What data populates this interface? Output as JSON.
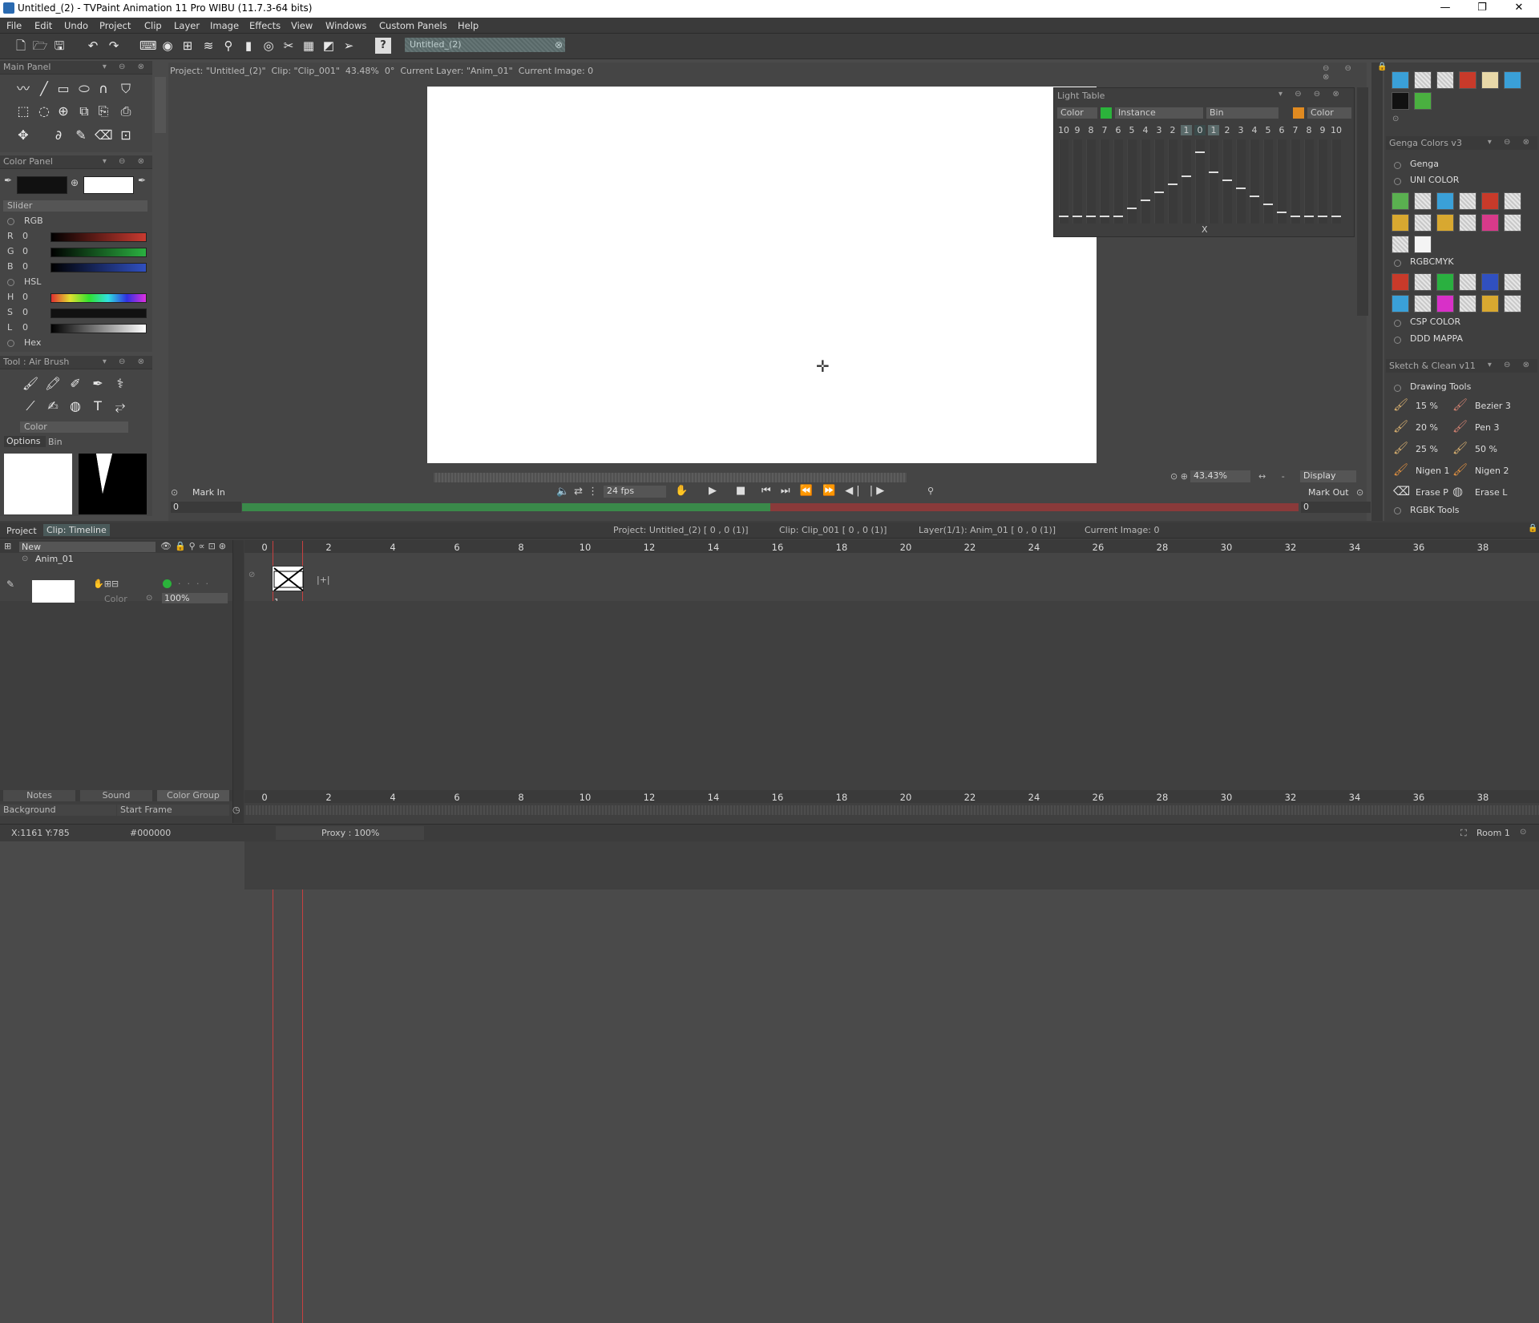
{
  "window": {
    "title": "Untitled_(2) - TVPaint Animation 11 Pro WIBU (11.7.3-64 bits)",
    "minimize": "—",
    "maximize": "❐",
    "close": "✕"
  },
  "menu": [
    "File",
    "Edit",
    "Undo",
    "Project",
    "Clip",
    "Layer",
    "Image",
    "Effects",
    "View",
    "Windows",
    "Custom Panels",
    "Help"
  ],
  "toolbar": {
    "doc_tab": "Untitled_(2)"
  },
  "main_panel": {
    "title": "Main Panel"
  },
  "info_bar": "Project: \"Untitled_(2)\"  Clip: \"Clip_001\"  43.48%  0°  Current Layer: \"Anim_01\"  Current Image: 0",
  "color_panel": {
    "title": "Color Panel",
    "slider_label": "Slider",
    "rgb_label": "RGB",
    "hsl_label": "HSL",
    "hex_label": "Hex",
    "rows": [
      {
        "label": "R",
        "value": "0"
      },
      {
        "label": "G",
        "value": "0"
      },
      {
        "label": "B",
        "value": "0"
      },
      {
        "label": "H",
        "value": "0"
      },
      {
        "label": "S",
        "value": "0"
      },
      {
        "label": "L",
        "value": "0"
      }
    ],
    "primary_color": "#111111",
    "secondary_color": "#ffffff"
  },
  "tool_panel": {
    "title": "Tool : Air Brush",
    "mode": "Color",
    "tabs": [
      "Options",
      "Bin"
    ]
  },
  "light_table": {
    "title": "Light Table",
    "header": {
      "color1": "Color",
      "instance": "Instance",
      "bin": "Bin",
      "color2": "Color"
    },
    "numbers": [
      "10",
      "9",
      "8",
      "7",
      "6",
      "5",
      "4",
      "3",
      "2",
      "1",
      "0",
      "1",
      "2",
      "3",
      "4",
      "5",
      "6",
      "7",
      "8",
      "9",
      "10"
    ],
    "x_label": "X"
  },
  "playback": {
    "mark_in": "Mark In",
    "fps": "24 fps",
    "mark_out": "Mark Out",
    "start_value": "0",
    "end_value": "0",
    "zoom": "43.43%",
    "display": "Display"
  },
  "right_panel": {
    "genga_title": "Genga Colors v3",
    "genga": "Genga",
    "uni_color": "UNI COLOR",
    "rgbcmyk": "RGBCMYK",
    "csp_color": "CSP COLOR",
    "ddd_mappa": "DDD MAPPA",
    "sketch_title": "Sketch & Clean v11",
    "drawing_tools": "Drawing Tools",
    "tools": [
      {
        "left": "15 %",
        "right": "Bezier 3"
      },
      {
        "left": "20 %",
        "right": "Pen 3"
      },
      {
        "left": "25 %",
        "right": "50 %"
      },
      {
        "left": "Nigen 1",
        "right": "Nigen 2"
      },
      {
        "left": "Erase P",
        "right": "Erase L"
      }
    ],
    "rgbk_tools": "RGBK Tools"
  },
  "timeline": {
    "tabs": [
      "Project",
      "Clip: Timeline"
    ],
    "info": {
      "project": "Project: Untitled_(2) [ 0 , 0  (1)]",
      "clip": "Clip: Clip_001 [ 0 , 0  (1)]",
      "layer": "Layer(1/1): Anim_01 [ 0 , 0  (1)]",
      "image": "Current Image: 0"
    },
    "new_label": "New",
    "layer_name": "Anim_01",
    "blend_mode": "Color",
    "opacity": "100%",
    "frame_label": "1",
    "ruler": [
      "0",
      "2",
      "4",
      "6",
      "8",
      "10",
      "12",
      "14",
      "16",
      "18",
      "20",
      "22",
      "24",
      "26",
      "28",
      "30",
      "32",
      "34",
      "36",
      "38"
    ],
    "bottom_tabs": [
      "Notes",
      "Sound",
      "Color Group"
    ],
    "background_label": "Background",
    "start_frame_label": "Start Frame"
  },
  "status": {
    "coords": "X:1161  Y:785",
    "color": "#000000",
    "proxy": "Proxy : 100%",
    "room": "Room 1"
  }
}
